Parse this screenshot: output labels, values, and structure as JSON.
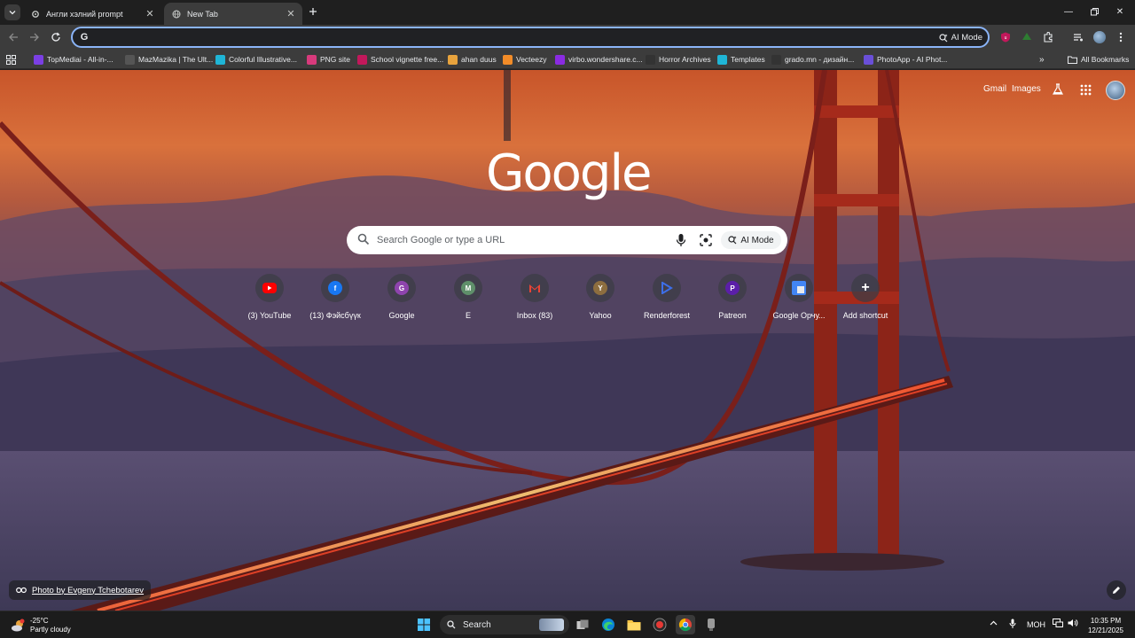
{
  "tabs": [
    {
      "title": "Англи хэлний prompt",
      "icon": "gear-icon",
      "active": false
    },
    {
      "title": "New Tab",
      "icon": "globe-icon",
      "active": true
    }
  ],
  "omnibox": {
    "placeholder": "",
    "value": "",
    "ai_mode": "AI Mode"
  },
  "bookmarks": {
    "items": [
      {
        "label": "TopMediai - All-in-...",
        "icon": "ai-icon",
        "color": "#7b3fe4"
      },
      {
        "label": "MazMazika | The Ult...",
        "icon": "mazmazika-icon",
        "color": "#555555"
      },
      {
        "label": "Colorful Illustrative...",
        "icon": "canva-icon",
        "color": "#1fb5d6"
      },
      {
        "label": "PNG site",
        "icon": "pngsite-icon",
        "color": "#d83a7c"
      },
      {
        "label": "School vignette free...",
        "icon": "flower-icon",
        "color": "#c2185b"
      },
      {
        "label": "ahan duus",
        "icon": "document-icon",
        "color": "#e8a33d"
      },
      {
        "label": "Vecteezy",
        "icon": "vecteezy-icon",
        "color": "#f28c28"
      },
      {
        "label": "virbo.wondershare.c...",
        "icon": "virbo-icon",
        "color": "#8a2be2"
      },
      {
        "label": "Horror Archives",
        "icon": "google-icon",
        "color": "#333333"
      },
      {
        "label": "Templates",
        "icon": "canva-icon",
        "color": "#1fb5d6"
      },
      {
        "label": "grado.mn - дизайн...",
        "icon": "grado-icon",
        "color": "#333333"
      },
      {
        "label": "PhotoApp - AI Phot...",
        "icon": "photoapp-icon",
        "color": "#6a4fd8"
      }
    ],
    "all_bookmarks": "All Bookmarks"
  },
  "ntp": {
    "links": {
      "gmail": "Gmail",
      "images": "Images"
    },
    "logo": "Google",
    "search_placeholder": "Search Google or type a URL",
    "ai_mode": "AI Mode",
    "shortcuts": [
      {
        "label": "(3) YouTube",
        "letter": "",
        "icon": "youtube-icon",
        "color": "#ff0000"
      },
      {
        "label": "(13) Фэйсбүүк",
        "letter": "f",
        "icon": "facebook-icon",
        "color": "#1877f2"
      },
      {
        "label": "Google",
        "letter": "G",
        "icon": "google-letter-icon",
        "color": "#8e44ad"
      },
      {
        "label": "E",
        "letter": "M",
        "icon": "letter-m-icon",
        "color": "#5f8f6a"
      },
      {
        "label": "Inbox (83)",
        "letter": "M",
        "icon": "gmail-icon",
        "color": "#ea4335"
      },
      {
        "label": "Yahoo",
        "letter": "Y",
        "icon": "yahoo-icon",
        "color": "#8d6e3f"
      },
      {
        "label": "Renderforest",
        "letter": "",
        "icon": "renderforest-icon",
        "color": "#3d6fe8"
      },
      {
        "label": "Patreon",
        "letter": "P",
        "icon": "patreon-icon",
        "color": "#5b1fa8"
      },
      {
        "label": "Google Орчу...",
        "letter": "",
        "icon": "google-translate-icon",
        "color": "#4285f4"
      },
      {
        "label": "Add shortcut",
        "letter": "+",
        "icon": "plus-icon",
        "color": "transparent"
      }
    ],
    "photo_credit": "Photo by Evgeny Tchebotarev"
  },
  "taskbar": {
    "weather_temp": "-25°C",
    "weather_desc": "Partly cloudy",
    "search": "Search",
    "language": "МОН",
    "time": "10:35 PM",
    "date": "12/21/2025"
  },
  "colors": {
    "accent": "#8ab4f8",
    "sky_top": "#c8552a",
    "sky_bottom": "#3b3a5e",
    "bridge": "#b8321f"
  }
}
